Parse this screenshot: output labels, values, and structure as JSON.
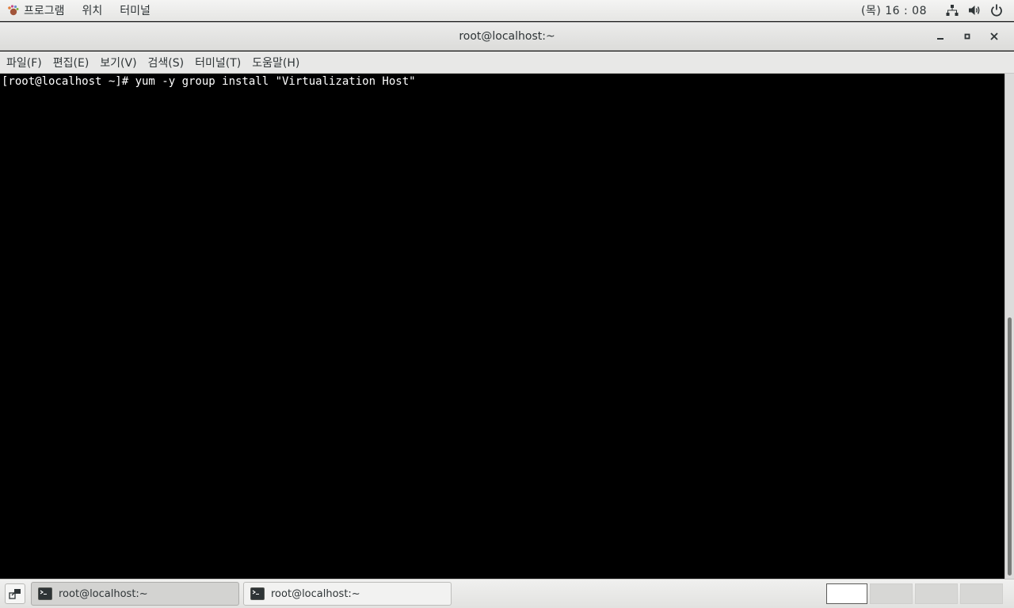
{
  "top_panel": {
    "menu": [
      {
        "label": "프로그램",
        "icon": "gnome-foot-icon"
      },
      {
        "label": "위치"
      },
      {
        "label": "터미널"
      }
    ],
    "clock": "(목) 16 : 08",
    "tray_icons": [
      "network-icon",
      "volume-icon",
      "power-icon"
    ]
  },
  "window": {
    "title": "root@localhost:~",
    "controls": {
      "minimize": "_",
      "maximize": "▫",
      "close": "✕"
    }
  },
  "menubar": {
    "items": [
      "파일(F)",
      "편집(E)",
      "보기(V)",
      "검색(S)",
      "터미널(T)",
      "도움말(H)"
    ]
  },
  "terminal": {
    "lines": [
      "[root@localhost ~]# yum -y group install \"Virtualization Host\""
    ]
  },
  "taskbar": {
    "tasks": [
      {
        "label": "root@localhost:~",
        "active": true
      },
      {
        "label": "root@localhost:~",
        "active": false
      }
    ],
    "workspace_count": 4,
    "active_workspace": 1
  },
  "colors": {
    "terminal_bg": "#000000",
    "terminal_fg": "#ffffff",
    "panel_bg": "#ececeb"
  }
}
